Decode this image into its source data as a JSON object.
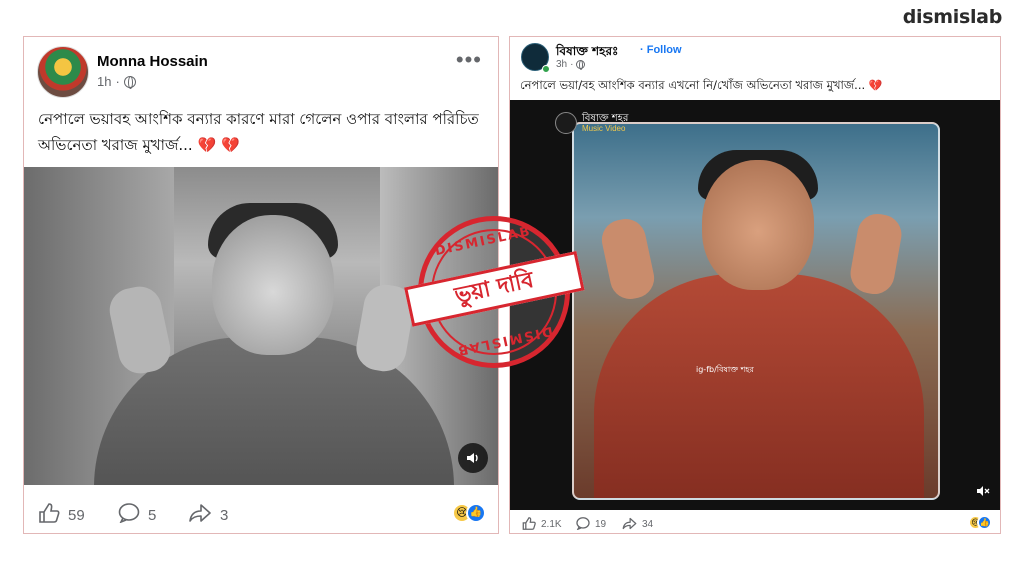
{
  "brand": "dismislab",
  "left_post": {
    "author": "Monna Hossain",
    "time": "1h",
    "more": "•••",
    "text": "নেপালে ভয়াবহ আংশিক বন্যার কারণে মারা গেলেন ওপার বাংলার পরিচিত অভিনেতা খরাজ মুখার্জ...",
    "hearts": "💔 💔",
    "likes": "59",
    "comments": "5",
    "shares": "3",
    "reactions": [
      "sad",
      "like"
    ]
  },
  "right_post": {
    "author": "বিষাক্ত শহরঃ",
    "follow": "· Follow",
    "time": "3h",
    "text": "নেপালে ভয়া/বহ আংশিক বন্যার এখনো নি/খোঁজ অভিনেতা খরাজ মুখার্জ...",
    "heart": "💔",
    "video_channel": "বিষাক্ত শহর",
    "video_sub": "Music Video",
    "video_caption": "ig-fb/বিষাক্ত শহর",
    "likes": "2.1K",
    "comments": "19",
    "shares": "34",
    "reactions": [
      "sad",
      "like"
    ]
  },
  "stamp": {
    "top": "DISMISLAB",
    "band": "ভুয়া দাবি",
    "bottom": "DISMISLAB",
    "color": "#d7262f"
  },
  "icons": [
    "globe-icon",
    "more-icon",
    "volume-icon",
    "mute-icon",
    "like-icon",
    "comment-icon",
    "share-icon",
    "sad-reaction-icon",
    "like-reaction-icon"
  ]
}
